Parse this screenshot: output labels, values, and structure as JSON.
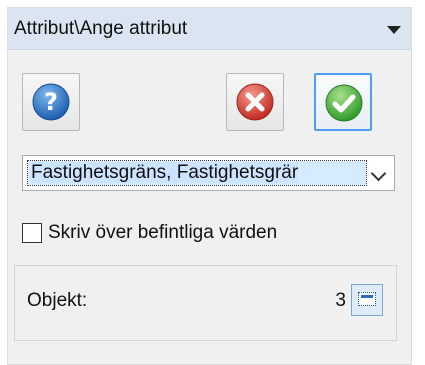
{
  "panel": {
    "title": "Attribut\\Ange attribut"
  },
  "toolbar": {
    "help_icon": "help-question-icon",
    "cancel_icon": "cancel-x-icon",
    "ok_icon": "ok-checkmark-icon"
  },
  "attribute_select": {
    "value": "Fastighetsgräns, Fastighetsgrär"
  },
  "overwrite": {
    "label": "Skriv över befintliga värden",
    "checked": false
  },
  "objects": {
    "label": "Objekt:",
    "count": "3",
    "select_icon": "select-objects-icon"
  },
  "colors": {
    "header_bg": "#dbe5f1",
    "accent": "#4e9ef7",
    "cancel_red": "#d9302c",
    "ok_green": "#3aa935",
    "help_blue": "#2a78c9"
  }
}
